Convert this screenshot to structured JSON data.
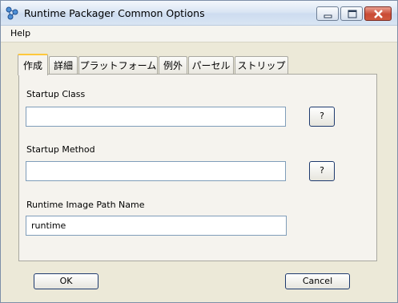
{
  "window": {
    "title": "Runtime Packager Common Options"
  },
  "menu": {
    "items": [
      {
        "label": "Help"
      }
    ]
  },
  "tabs": [
    {
      "label": "作成",
      "active": true
    },
    {
      "label": "詳細",
      "active": false
    },
    {
      "label": "プラットフォーム",
      "active": false
    },
    {
      "label": "例外",
      "active": false
    },
    {
      "label": "パーセル",
      "active": false
    },
    {
      "label": "ストリップ",
      "active": false
    }
  ],
  "form": {
    "startup_class": {
      "label": "Startup Class",
      "value": "",
      "help_label": "?"
    },
    "startup_method": {
      "label": "Startup Method",
      "value": "",
      "help_label": "?"
    },
    "runtime_image_path": {
      "label": "Runtime Image Path Name",
      "value": "runtime"
    }
  },
  "buttons": {
    "ok": "OK",
    "cancel": "Cancel"
  },
  "icons": {
    "app": "network-icon",
    "minimize": "minimize-icon",
    "maximize": "maximize-icon",
    "close": "close-icon"
  },
  "colors": {
    "active_tab_accent": "#ffc83c",
    "close_button": "#c94a35"
  }
}
